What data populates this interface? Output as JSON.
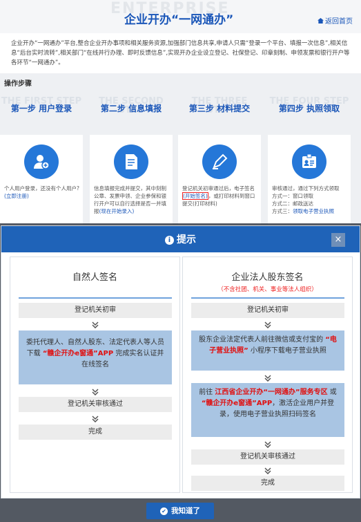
{
  "header": {
    "bg_word": "ENTERPRISE",
    "title": "企业开办“一网通办”",
    "home_link": "返回首页"
  },
  "intro": "企业开办“一网通办”平台,整合企业开办事项和相关服务资源,加强部门信息共享,申请人只需“登录一个平台、填报一次信息”,相关信息“后台实时流转”,相关部门“在线并行办理、即时反馈信息”,实现开办企业设立登记、社保登记、印章刻制、申领发票和银行开户等各环节“一网通办”。",
  "steps_label": "操作步骤",
  "steps": [
    {
      "ghost": "THE FIRST STEP",
      "label": "第一步 用户登录",
      "icon": "user-add-icon",
      "text_a": "个人用户登录，还没有个人用户?",
      "link": "(立即注册)",
      "text_b": ""
    },
    {
      "ghost": "THE SECOND STEP",
      "label": "第二步 信息填报",
      "icon": "document-icon",
      "text_a": "信息填报完成并提交，其中刻制公章、发票申领、企业参保和银行开户可以自行选择是否一并填报",
      "link": "(现在开始录入)",
      "text_b": ""
    },
    {
      "ghost": "THE THREE STEP",
      "label": "第三步 材料提交",
      "icon": "pen-icon",
      "text_a": "登记机关初审通过后，电子签名",
      "link": "(开始签名)",
      "text_b": "，或打印材料到窗口提交(打印材料)"
    },
    {
      "ghost": "THE FOUR STEP",
      "label": "第四步 执照领取",
      "icon": "license-card-icon",
      "text_a": "审核通过，通过下列方式领取",
      "lines": [
        "方式一：窗口领取",
        "方式二：邮政送达",
        "方式三："
      ],
      "link": "领取电子营业执照",
      "text_b": ""
    }
  ],
  "modal": {
    "title": "提示",
    "close": "×",
    "left": {
      "title": "自然人签名",
      "box1": "登记机关初审",
      "blue_a": "委托代理人、自然人股东、法定代表人等人员下载 ",
      "blue_red": "“赣企开办e窗通”APP",
      "blue_b": " 完成实名认证并在线签名",
      "box2": "登记机关审核通过",
      "box3": "完成"
    },
    "right": {
      "title": "企业法人股东签名",
      "subtitle": "（不含社团、机关、事业等法人组织）",
      "box1": "登记机关初审",
      "blue1_a": "股东企业法定代表人前往微信或支付宝的 ",
      "blue1_red": "“电子营业执照”",
      "blue1_b": " 小程序下载电子营业执照",
      "blue2_a": "前往 ",
      "blue2_red1": "江西省企业开办“一网通办”服务专区",
      "blue2_b": " 或 ",
      "blue2_red2": "“赣企开办e窗通”APP",
      "blue2_c": "，激活企业用户并登录，使用电子营业执照扫码签名",
      "box2": "登记机关审核通过",
      "box3": "完成"
    },
    "ok_button": "我知道了"
  },
  "colors": {
    "primary": "#1f63b8",
    "red": "#e01010",
    "box_blue": "#a9c5e3"
  }
}
